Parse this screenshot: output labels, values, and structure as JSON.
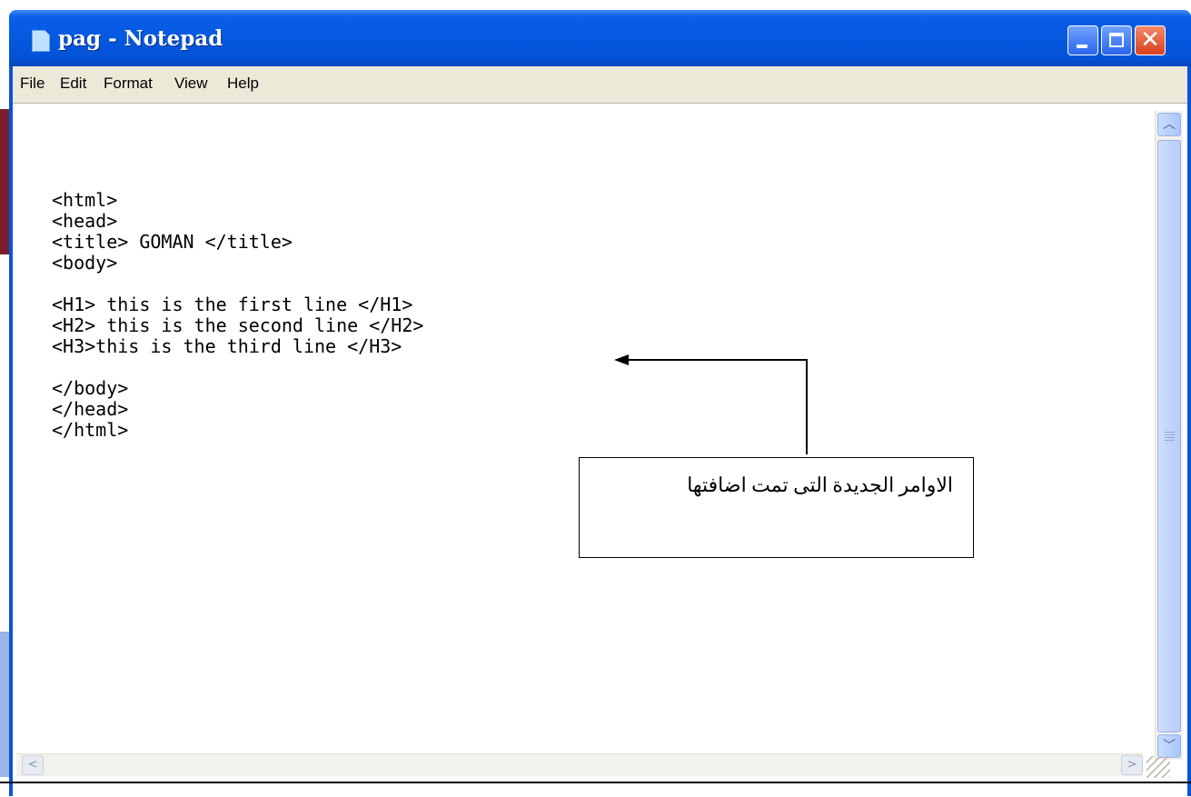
{
  "window": {
    "title": "pag - Notepad",
    "controls": {
      "minimize": "minimize",
      "maximize": "maximize",
      "close": "✕"
    }
  },
  "menu": {
    "items": [
      {
        "label": "File"
      },
      {
        "label": "Edit"
      },
      {
        "label": "Format"
      },
      {
        "label": "View"
      },
      {
        "label": "Help"
      }
    ]
  },
  "editor": {
    "content": "<html>\n<head>\n<title> GOMAN </title>\n<body>\n\n<H1> this is the first line </H1>\n<H2> this is the second line </H2>\n<H3>this is the third line </H3>\n\n</body>\n</head>\n</html>"
  },
  "annotation": {
    "text": "الاوامر الجديدة التى تمت اضافتها"
  },
  "colors": {
    "titlebar": "#0558e0",
    "menubar": "#ece9d8",
    "close_button": "#d8401e",
    "desktop_accent": "#7a1f2b"
  },
  "icons": {
    "app": "notepad-icon",
    "scroll_up": "chevron-up-icon",
    "scroll_down": "chevron-down-icon",
    "scroll_left": "chevron-left-icon",
    "scroll_right": "chevron-right-icon"
  }
}
